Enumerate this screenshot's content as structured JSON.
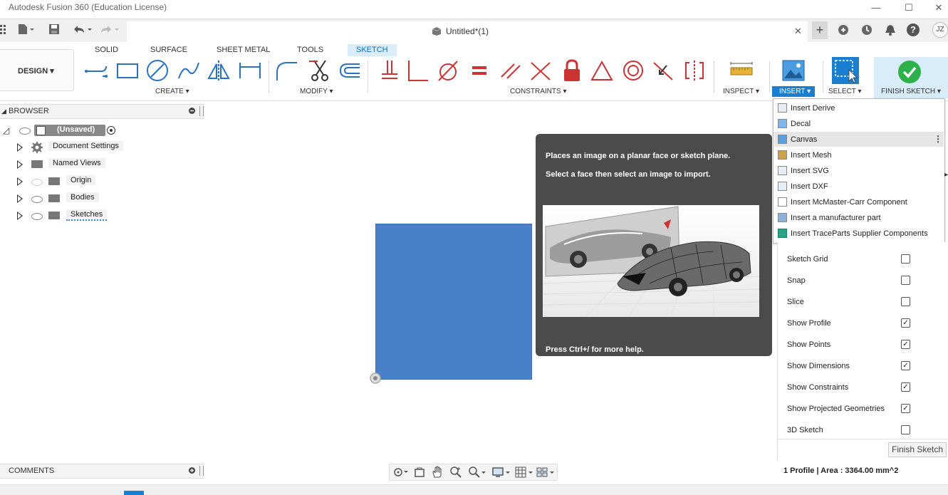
{
  "window": {
    "title": "Autodesk Fusion 360 (Education License)",
    "minimize": "—",
    "maximize": "☐",
    "close": "✕"
  },
  "tabbar": {
    "doc_title": "Untitled*(1)",
    "close": "✕",
    "add": "+",
    "user_initials": "JZ",
    "help": "?"
  },
  "ribbon": {
    "workspace": "DESIGN ▾",
    "tabs": [
      "SOLID",
      "SURFACE",
      "SHEET METAL",
      "TOOLS",
      "SKETCH"
    ],
    "active_tab": "SKETCH",
    "groups": {
      "create": "CREATE ▾",
      "modify": "MODIFY ▾",
      "constraints": "CONSTRAINTS ▾",
      "inspect": "INSPECT ▾",
      "insert": "INSERT ▾",
      "select": "SELECT ▾",
      "finish": "FINISH SKETCH ▾"
    }
  },
  "browser": {
    "title": "BROWSER",
    "root": "(Unsaved)",
    "items": [
      {
        "label": "Document Settings",
        "icon": "gear-icon"
      },
      {
        "label": "Named Views",
        "icon": "folder-icon"
      },
      {
        "label": "Origin",
        "icon": "folder-icon"
      },
      {
        "label": "Bodies",
        "icon": "folder-icon"
      },
      {
        "label": "Sketches",
        "icon": "folder-icon"
      }
    ]
  },
  "tooltip": {
    "line1": "Places an image on a planar face or sketch plane.",
    "line2": "Select a face then select an image to import.",
    "help": "Press Ctrl+/ for more help."
  },
  "insert_menu": {
    "items": [
      {
        "label": "Insert Derive",
        "icon": "derive-icon"
      },
      {
        "label": "Decal",
        "icon": "decal-icon"
      },
      {
        "label": "Canvas",
        "icon": "canvas-icon"
      },
      {
        "label": "Insert Mesh",
        "icon": "mesh-icon"
      },
      {
        "label": "Insert SVG",
        "icon": "svg-icon"
      },
      {
        "label": "Insert DXF",
        "icon": "dxf-icon"
      },
      {
        "label": "Insert McMaster-Carr Component",
        "icon": "mcmaster-icon"
      },
      {
        "label": "Insert a manufacturer part",
        "icon": "manufacturer-icon"
      },
      {
        "label": "Insert TraceParts Supplier Components",
        "icon": "traceparts-icon"
      }
    ],
    "highlighted": "Canvas"
  },
  "palette": {
    "options": [
      {
        "label": "Sketch Grid",
        "checked": false
      },
      {
        "label": "Snap",
        "checked": false
      },
      {
        "label": "Slice",
        "checked": false
      },
      {
        "label": "Show Profile",
        "checked": true
      },
      {
        "label": "Show Points",
        "checked": true
      },
      {
        "label": "Show Dimensions",
        "checked": true
      },
      {
        "label": "Show Constraints",
        "checked": true
      },
      {
        "label": "Show Projected Geometries",
        "checked": true
      },
      {
        "label": "3D Sketch",
        "checked": false
      }
    ],
    "finish_button": "Finish Sketch"
  },
  "comments": {
    "title": "COMMENTS"
  },
  "status": {
    "text": "1 Profile | Area : 3364.00 mm^2"
  },
  "colors": {
    "sketch_fill": "#4a80c8",
    "accent": "#0a6ec0",
    "insert_active": "#1a7fd0",
    "finish_green": "#2db14a",
    "constraint_red": "#cc3333"
  }
}
